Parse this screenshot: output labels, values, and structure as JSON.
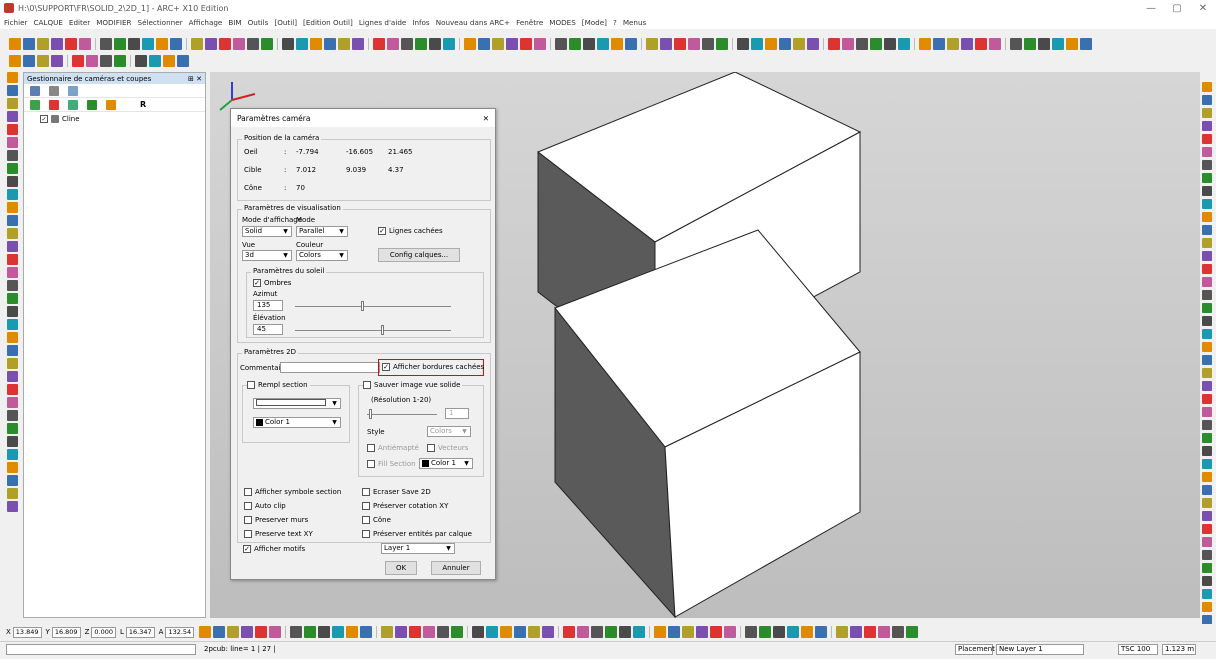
{
  "window": {
    "title": "H:\\0\\SUPPORT\\FR\\SOLID_2\\2D_1] - ARC+ X10 Edition",
    "minimize": "—",
    "maximize": "▢",
    "close": "✕"
  },
  "menu": [
    "Fichier",
    "CALQUE",
    "Editer",
    "MODIFIER",
    "Sélectionner",
    "Affichage",
    "BIM",
    "Outils",
    "[Outil]",
    "[Edition Outil]",
    "Lignes d'aide",
    "Infos",
    "Nouveau dans ARC+",
    "Fenêtre",
    "MODES",
    "[Mode]",
    "?",
    "Menus"
  ],
  "panel": {
    "title": "Gestionnaire de caméras et coupes",
    "pin": "⊞ ✕",
    "r_label": "R",
    "tree_item": "Cline"
  },
  "dialog": {
    "title": "Paramètres caméra",
    "close": "✕",
    "camera_position": {
      "label": "Position de la caméra",
      "rows": [
        {
          "name": "Oeil",
          "x": "-7.794",
          "y": "-16.605",
          "z": "21.465"
        },
        {
          "name": "Cible",
          "x": "7.012",
          "y": "9.039",
          "z": "4.37"
        },
        {
          "name": "Cône",
          "x": "70",
          "y": "",
          "z": ""
        }
      ]
    },
    "visualisation": {
      "label": "Paramètres de visualisation",
      "display_mode_label": "Mode d'affichage",
      "display_mode": "Solid",
      "mode_label": "Mode",
      "mode": "Parallel",
      "hidden_lines": "Lignes cachées",
      "view_label": "Vue",
      "view": "3d",
      "color_label": "Couleur",
      "color": "Colors",
      "config_button": "Config calques...",
      "sun": {
        "label": "Paramètres du soleil",
        "shadows": "Ombres",
        "azimuth_label": "Azimut",
        "azimuth": "135",
        "elevation_label": "Élévation",
        "elevation": "45"
      }
    },
    "params2d": {
      "label": "Paramètres 2D",
      "comment_label": "Commentaire",
      "hidden_edges": "Afficher bordures cachées",
      "fill_section": "Rempl section",
      "fill_color": "Color 1",
      "save_image": "Sauver image vue solide",
      "resolution": "(Résolution 1-20)",
      "resolution_value": "1",
      "style_label": "Style",
      "style": "Colors",
      "anti_alias": "Antiémapté",
      "vectors": "Vecteurs",
      "fill_section2": "Fill Section",
      "color2": "Color 1"
    },
    "options_left": [
      "Afficher symbole section",
      "Auto clip",
      "Preserver murs",
      "Preserve text XY",
      "Afficher motifs"
    ],
    "options_right": [
      "Ecraser Save 2D",
      "Préserver cotation XY",
      "Cône",
      "Préserver entités par calque"
    ],
    "layer": "Layer 1",
    "ok": "OK",
    "cancel": "Annuler"
  },
  "bottombar": {
    "x_label": "X",
    "x": "13.849",
    "y_label": "Y",
    "y": "16.809",
    "z_label": "Z",
    "z": "0.000",
    "l_label": "L",
    "l": "16.347",
    "a_label": "A",
    "a": "132.54",
    "layer_field": "1"
  },
  "statusbar": {
    "info": "2pcub: line=  1 |  27 |",
    "placement": "Placement",
    "layer": "New Layer 1",
    "tsc": "TSC 100",
    "scale": "1.123 m"
  },
  "colors": {
    "accent_red": "#d01010",
    "panel_head": "#cfe0f3"
  }
}
